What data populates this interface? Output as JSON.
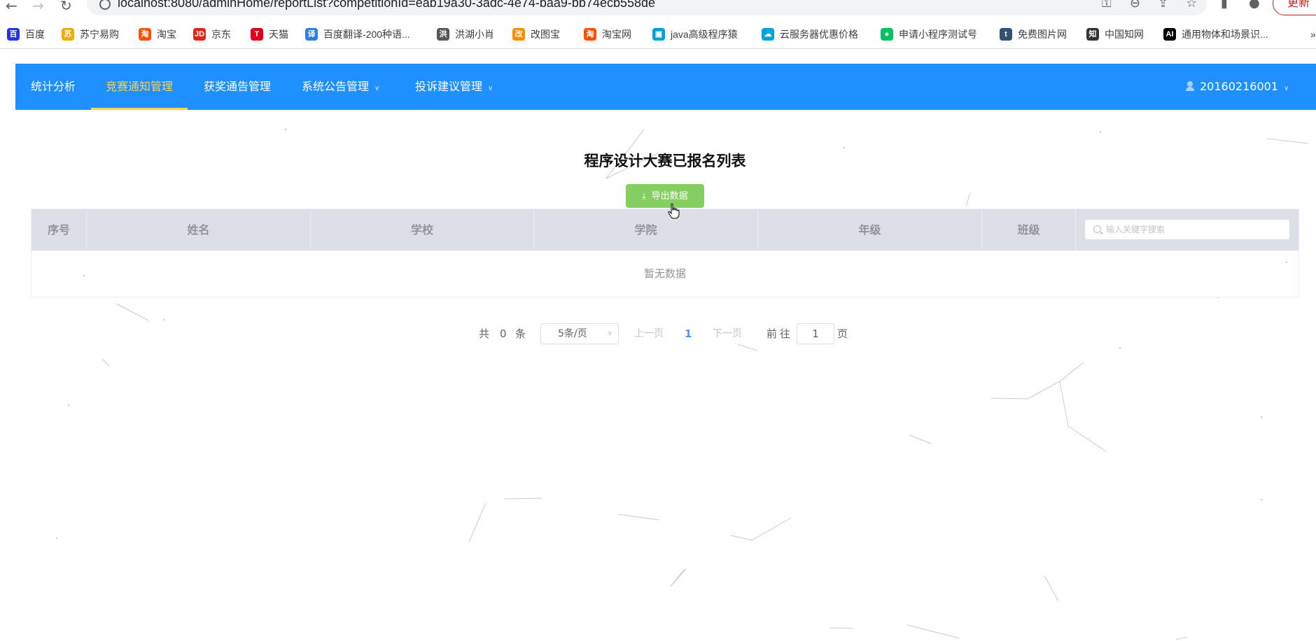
{
  "browser": {
    "url": "localhost:8080/adminHome/reportList?competitionId=eab19a30-3adc-4e74-baa9-bb74ecb558de",
    "update_label": "更新",
    "bookmarks": [
      {
        "label": "百度",
        "icon": "baidu-icon",
        "color": "#2932e1"
      },
      {
        "label": "苏宁易购",
        "icon": "suning-icon",
        "color": "#f2a900"
      },
      {
        "label": "淘宝",
        "icon": "taobao-icon",
        "color": "#ff5000"
      },
      {
        "label": "京东",
        "icon": "jd-icon",
        "color": "#e1251b"
      },
      {
        "label": "天猫",
        "icon": "tmall-icon",
        "color": "#e0001b"
      },
      {
        "label": "百度翻译-200种语...",
        "icon": "translate-icon",
        "color": "#2d7de6"
      },
      {
        "label": "洪湖小肖",
        "icon": "hawk-icon",
        "color": "#555555"
      },
      {
        "label": "改图宝",
        "icon": "gaitubao-icon",
        "color": "#ff8a00"
      },
      {
        "label": "淘宝网",
        "icon": "taobao-net-icon",
        "color": "#ff5000"
      },
      {
        "label": "java高级程序猿",
        "icon": "bilibili-icon",
        "color": "#00a1d6"
      },
      {
        "label": "云服务器优惠价格",
        "icon": "cloud-icon",
        "color": "#00a3e0"
      },
      {
        "label": "申请小程序测试号",
        "icon": "wechat-icon",
        "color": "#07c160"
      },
      {
        "label": "免费图片网",
        "icon": "tumblr-icon",
        "color": "#34526f"
      },
      {
        "label": "中国知网",
        "icon": "cnki-icon",
        "color": "#333333"
      },
      {
        "label": "通用物体和场景识...",
        "icon": "ai-icon",
        "color": "#000000"
      }
    ]
  },
  "navbar": {
    "items": [
      {
        "label": "统计分析",
        "active": false
      },
      {
        "label": "竞赛通知管理",
        "active": true
      },
      {
        "label": "获奖通告管理",
        "active": false
      },
      {
        "label": "系统公告管理",
        "active": false,
        "dropdown": true
      },
      {
        "label": "投诉建议管理",
        "active": false,
        "dropdown": true
      }
    ],
    "user": "20160216001",
    "bg_color": "#1e90ff",
    "active_color": "#ffd04b"
  },
  "main": {
    "title": "程序设计大赛已报名列表",
    "export_label": "导出数据",
    "table": {
      "columns": [
        "序号",
        "姓名",
        "学校",
        "学院",
        "年级",
        "班级"
      ],
      "search_placeholder": "输入关键字搜索",
      "empty_text": "暂无数据"
    },
    "pagination": {
      "total_prefix": "共",
      "total": "0",
      "total_suffix": "条",
      "page_size": "5条/页",
      "prev": "上一页",
      "current": "1",
      "next": "下一页",
      "goto_prefix": "前往",
      "goto_value": "1",
      "goto_suffix": "页"
    }
  }
}
